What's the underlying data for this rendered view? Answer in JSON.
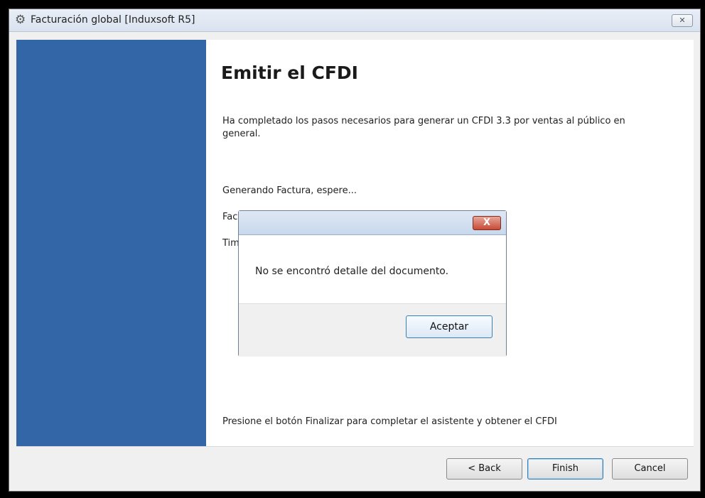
{
  "window": {
    "title": "Facturación global [Induxsoft R5]",
    "close_label": "✕"
  },
  "wizard": {
    "heading": "Emitir el CFDI",
    "intro": "Ha completado los pasos necesarios para generar un CFDI 3.3 por ventas al público en general.",
    "status_generating": "Generando Factura, espere...",
    "status_factura_prefix": "Fac",
    "status_timbrado_prefix": "Tim",
    "footer_instruction": "Presione el botón Finalizar para completar el asistente y obtener el CFDI"
  },
  "buttons": {
    "back": "< Back",
    "finish": "Finish",
    "cancel": "Cancel"
  },
  "dialog": {
    "message": "No se encontró detalle del documento.",
    "ok": "Aceptar",
    "close_label": "X"
  },
  "icons": {
    "app": "gear-icon"
  }
}
